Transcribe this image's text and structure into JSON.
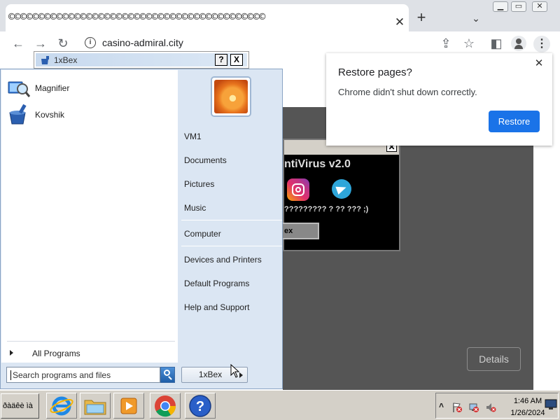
{
  "browser": {
    "tab_title": "©©©©©©©©©©©©©©©©©©©©©©©©©©©©©©©©©©©©©©©©©©©",
    "url": "casino-admiral.city",
    "details_label": "Details"
  },
  "restore_dialog": {
    "title": "Restore pages?",
    "message": "Chrome didn't shut down correctly.",
    "button": "Restore"
  },
  "antivirus": {
    "title": "ntiVirus v2.0",
    "text": "????????? ? ?? ??? ;)",
    "button": "ex"
  },
  "bex_window": {
    "title": "1xBex",
    "help": "?",
    "close": "X"
  },
  "start_menu": {
    "programs": [
      {
        "label": "Magnifier",
        "icon": "magnifier-icon"
      },
      {
        "label": "Kovshik",
        "icon": "kovshik-icon"
      }
    ],
    "all_programs": "All Programs",
    "search_placeholder": "Search programs and files",
    "right_items": [
      "VM1",
      "Documents",
      "Pictures",
      "Music",
      "Computer",
      "Devices and Printers",
      "Default Programs",
      "Help and Support"
    ],
    "shutdown_label": "1xBex"
  },
  "taskbar": {
    "start_label": "ðàäêè ìà",
    "apps": [
      "internet-explorer-icon",
      "file-explorer-icon",
      "media-player-icon",
      "chrome-icon",
      "help-icon"
    ],
    "time": "1:46 AM",
    "date": "1/26/2024"
  },
  "colors": {
    "restore_button": "#1a73e8",
    "start_menu_bg": "#dbe6f3",
    "taskbar_bg": "#d4d0c8"
  }
}
